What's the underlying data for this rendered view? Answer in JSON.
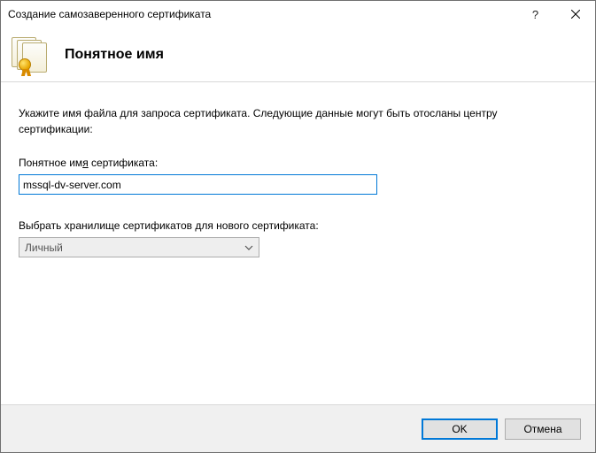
{
  "window": {
    "title": "Создание самозаверенного сертификата"
  },
  "header": {
    "title": "Понятное имя"
  },
  "body": {
    "instruction": "Укажите имя файла для запроса сертификата. Следующие данные могут быть отосланы центру сертификации:",
    "name_label_prefix": "Понятное им",
    "name_label_underlined": "я",
    "name_label_suffix": " сертификата:",
    "name_value": "mssql-dv-server.com",
    "store_label": "Выбрать хранилище сертификатов для нового сертификата:",
    "store_value": "Личный"
  },
  "footer": {
    "ok": "OK",
    "cancel": "Отмена"
  }
}
